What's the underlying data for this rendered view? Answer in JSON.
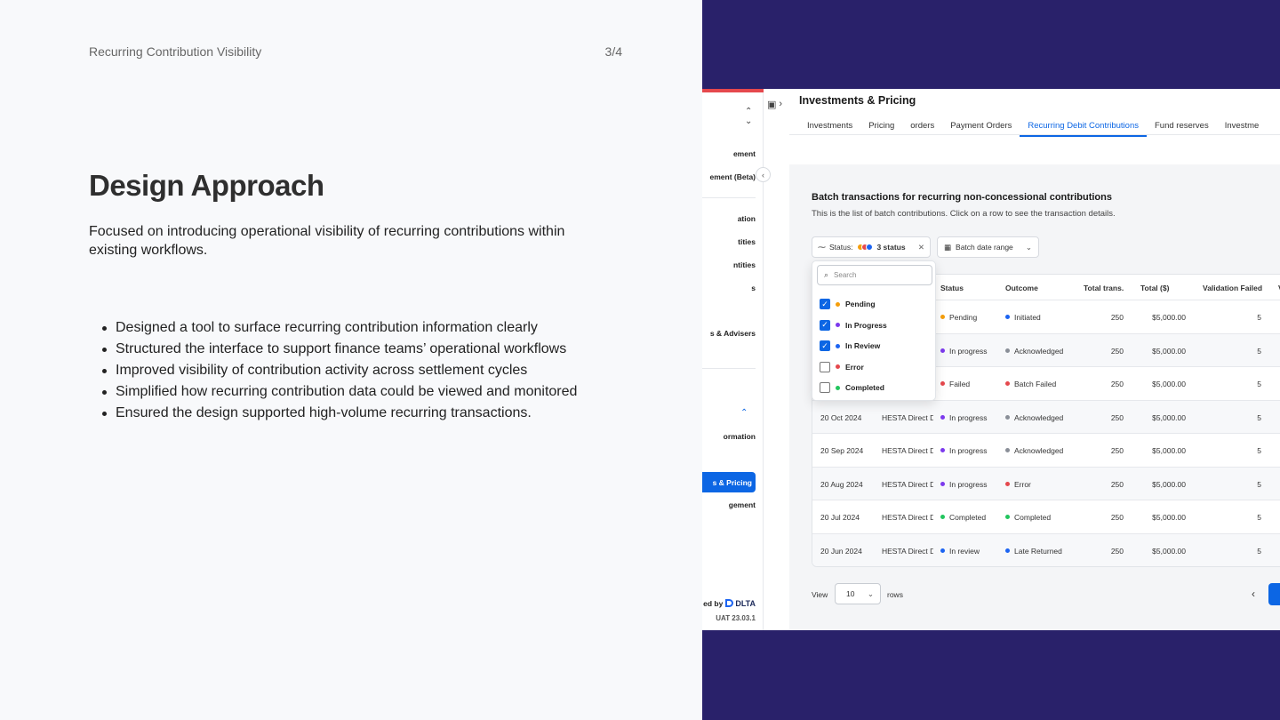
{
  "slide": {
    "header_title": "Recurring Contribution Visibility",
    "page_number": "3/4",
    "title": "Design Approach",
    "intro": "Focused on introducing operational visibility of recurring contributions within existing workflows.",
    "bullets": [
      "Designed a tool to surface recurring contribution information clearly",
      "Structured the interface to support finance teams’ operational workflows",
      "Improved visibility of contribution activity across settlement cycles",
      "Simplified how recurring contribution data could be viewed and monitored",
      "Ensured the design supported high-volume recurring transactions."
    ]
  },
  "app": {
    "sidebar": {
      "items": [
        "ement",
        "ement (Beta)",
        "ation",
        "tities",
        "ntities",
        "s",
        "s & Advisers",
        "ormation",
        "gement"
      ],
      "active_item": "s & Pricing",
      "footer_prefix": "ed by",
      "logo_text": "DLTA",
      "version": "UAT 23.03.1"
    },
    "page_title": "Investments & Pricing",
    "tabs": [
      "Investments",
      "Pricing",
      "orders",
      "Payment Orders",
      "Recurring Debit Contributions",
      "Fund reserves",
      "Investme"
    ],
    "active_tab": "Recurring Debit Contributions",
    "section_title": "Batch transactions for recurring non-concessional contributions",
    "section_subtitle": "This is the list of batch contributions. Click on a row to see the transaction details.",
    "filters": {
      "status_label": "Status:",
      "status_value": "3 status",
      "date_label": "Batch date range"
    },
    "dropdown": {
      "search_placeholder": "Search",
      "options": [
        {
          "label": "Pending",
          "checked": true,
          "color": "#f59e0b"
        },
        {
          "label": "In Progress",
          "checked": true,
          "color": "#7c3aed"
        },
        {
          "label": "In Review",
          "checked": true,
          "color": "#1c64f2"
        },
        {
          "label": "Error",
          "checked": false,
          "color": "#e5484d"
        },
        {
          "label": "Completed",
          "checked": false,
          "color": "#22c55e"
        }
      ]
    },
    "table": {
      "headers": [
        "Status",
        "Outcome",
        "Total trans.",
        "Total ($)",
        "Validation Failed",
        "V"
      ],
      "rows": [
        {
          "date": "",
          "fund": "",
          "status": "Pending",
          "status_color": "#f59e0b",
          "outcome": "Initiated",
          "outcome_color": "#1c64f2",
          "total_trans": "250",
          "total": "$5,000.00",
          "failed": "5"
        },
        {
          "date": "",
          "fund": "",
          "status": "In progress",
          "status_color": "#7c3aed",
          "outcome": "Acknowledged",
          "outcome_color": "#8a8f98",
          "total_trans": "250",
          "total": "$5,000.00",
          "failed": "5"
        },
        {
          "date": "",
          "fund": "",
          "status": "Failed",
          "status_color": "#e5484d",
          "outcome": "Batch Failed",
          "outcome_color": "#e5484d",
          "total_trans": "250",
          "total": "$5,000.00",
          "failed": "5"
        },
        {
          "date": "20 Oct 2024",
          "fund": "HESTA Direct D",
          "status": "In progress",
          "status_color": "#7c3aed",
          "outcome": "Acknowledged",
          "outcome_color": "#8a8f98",
          "total_trans": "250",
          "total": "$5,000.00",
          "failed": "5"
        },
        {
          "date": "20 Sep 2024",
          "fund": "HESTA Direct D",
          "status": "In progress",
          "status_color": "#7c3aed",
          "outcome": "Acknowledged",
          "outcome_color": "#8a8f98",
          "total_trans": "250",
          "total": "$5,000.00",
          "failed": "5"
        },
        {
          "date": "20 Aug 2024",
          "fund": "HESTA Direct D",
          "status": "In progress",
          "status_color": "#7c3aed",
          "outcome": "Error",
          "outcome_color": "#e5484d",
          "total_trans": "250",
          "total": "$5,000.00",
          "failed": "5"
        },
        {
          "date": "20 Jul 2024",
          "fund": "HESTA Direct D",
          "status": "Completed",
          "status_color": "#22c55e",
          "outcome": "Completed",
          "outcome_color": "#22c55e",
          "total_trans": "250",
          "total": "$5,000.00",
          "failed": "5"
        },
        {
          "date": "20 Jun 2024",
          "fund": "HESTA Direct D",
          "status": "In review",
          "status_color": "#1c64f2",
          "outcome": "Late Returned",
          "outcome_color": "#1c64f2",
          "total_trans": "250",
          "total": "$5,000.00",
          "failed": "5"
        }
      ]
    },
    "pagination": {
      "view_label": "View",
      "page_size": "10",
      "rows_label": "rows"
    }
  },
  "colors": {
    "accent": "#0c66e4",
    "panel_bg": "#29216a",
    "slide_bg": "#f8f9fb"
  }
}
